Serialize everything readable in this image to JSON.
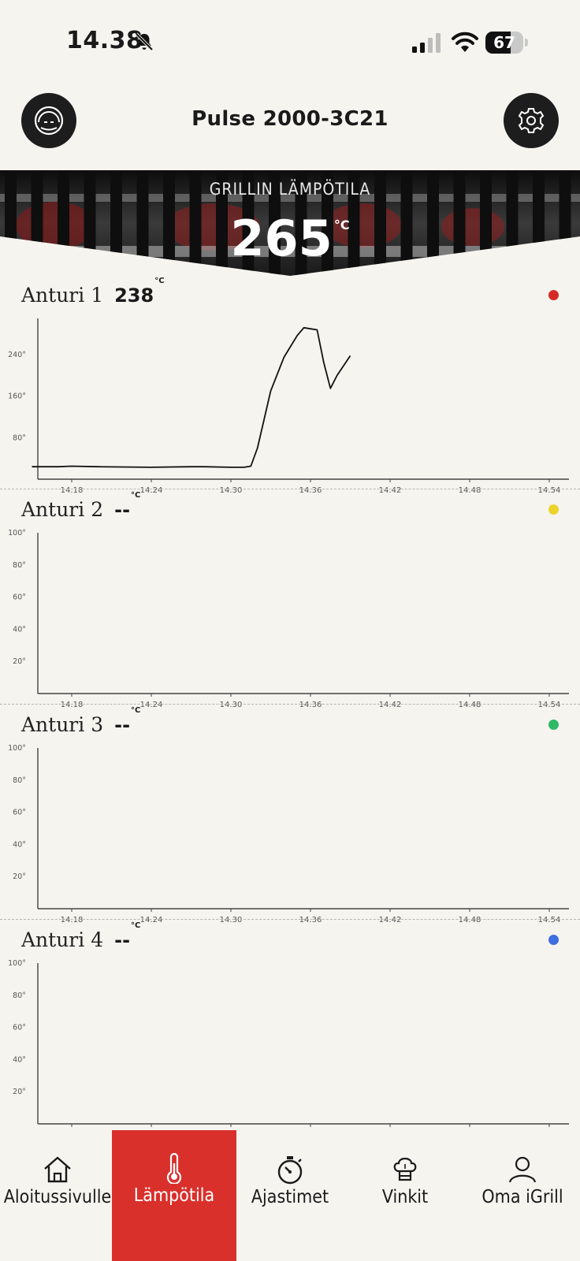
{
  "status_bar": {
    "time": "14.38",
    "battery": "67",
    "battery_level": 0.67
  },
  "header": {
    "device_name": "Pulse 2000-3C21"
  },
  "grill": {
    "label": "GRILLIN LÄMPÖTILA",
    "value": "265",
    "unit": "°C"
  },
  "probes": [
    {
      "name": "Anturi 1",
      "value": "238",
      "unit": "°C",
      "color": "#d62a25",
      "chart_data": {
        "type": "line",
        "x_ticks": [
          "14.18",
          "14.24",
          "14.30",
          "14.36",
          "14.42",
          "14.48",
          "14.54"
        ],
        "y_ticks": [
          "80°",
          "160°",
          "240°"
        ],
        "ylim": [
          0,
          310
        ],
        "series": [
          {
            "x": [
              "14.15",
              "14.17",
              "14.18",
              "14.20",
              "14.24",
              "14.27",
              "14.28",
              "14.30",
              "14.31",
              "14.315",
              "14.32",
              "14.33",
              "14.34",
              "14.35",
              "14.355",
              "14.36",
              "14.365",
              "14.37",
              "14.375",
              "14.38",
              "14.39"
            ],
            "values": [
              24,
              24,
              25,
              24,
              23,
              24,
              24,
              23,
              23,
              25,
              60,
              170,
              235,
              277,
              292,
              290,
              288,
              225,
              175,
              200,
              238
            ]
          }
        ]
      }
    },
    {
      "name": "Anturi 2",
      "value": "--",
      "unit": "°C",
      "color": "#ecd32b",
      "chart_data": {
        "type": "line",
        "x_ticks": [
          "14.18",
          "14.24",
          "14.30",
          "14.36",
          "14.42",
          "14.48",
          "14.54"
        ],
        "y_ticks": [
          "20°",
          "40°",
          "60°",
          "80°",
          "100°"
        ],
        "ylim": [
          0,
          100
        ],
        "series": []
      }
    },
    {
      "name": "Anturi 3",
      "value": "--",
      "unit": "°C",
      "color": "#2fb866",
      "chart_data": {
        "type": "line",
        "x_ticks": [
          "14.18",
          "14.24",
          "14.30",
          "14.36",
          "14.42",
          "14.48",
          "14.54"
        ],
        "y_ticks": [
          "20°",
          "40°",
          "60°",
          "80°",
          "100°"
        ],
        "ylim": [
          0,
          100
        ],
        "series": []
      }
    },
    {
      "name": "Anturi 4",
      "value": "--",
      "unit": "°C",
      "color": "#3f6fe0",
      "chart_data": {
        "type": "line",
        "x_ticks": [
          "14.18",
          "14.24",
          "14.30",
          "14.36",
          "14.42",
          "14.48",
          "14.54"
        ],
        "y_ticks": [
          "20°",
          "40°",
          "60°",
          "80°",
          "100°"
        ],
        "ylim": [
          0,
          100
        ],
        "series": []
      }
    }
  ],
  "nav": [
    {
      "label": "Aloitussivulle",
      "icon": "home-icon"
    },
    {
      "label": "Lämpötila",
      "icon": "thermometer-icon",
      "active": true
    },
    {
      "label": "Ajastimet",
      "icon": "stopwatch-icon"
    },
    {
      "label": "Vinkit",
      "icon": "chef-hat-icon"
    },
    {
      "label": "Oma iGrill",
      "icon": "user-icon"
    }
  ]
}
